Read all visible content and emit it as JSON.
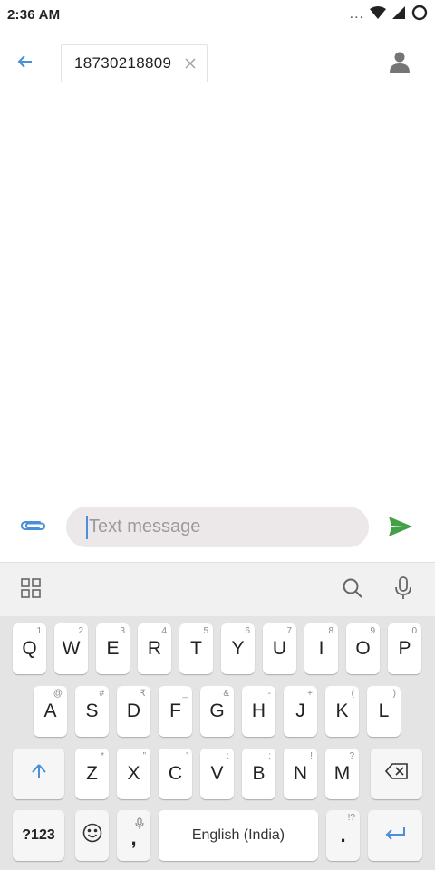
{
  "status_bar": {
    "time": "2:36 AM",
    "dots": "..."
  },
  "recipient": {
    "number": "18730218809"
  },
  "compose": {
    "placeholder": "Text message"
  },
  "keyboard": {
    "row1": [
      {
        "label": "Q",
        "hint": "1"
      },
      {
        "label": "W",
        "hint": "2"
      },
      {
        "label": "E",
        "hint": "3"
      },
      {
        "label": "R",
        "hint": "4"
      },
      {
        "label": "T",
        "hint": "5"
      },
      {
        "label": "Y",
        "hint": "6"
      },
      {
        "label": "U",
        "hint": "7"
      },
      {
        "label": "I",
        "hint": "8"
      },
      {
        "label": "O",
        "hint": "9"
      },
      {
        "label": "P",
        "hint": "0"
      }
    ],
    "row2": [
      {
        "label": "A",
        "hint": "@"
      },
      {
        "label": "S",
        "hint": "#"
      },
      {
        "label": "D",
        "hint": "₹"
      },
      {
        "label": "F",
        "hint": "_"
      },
      {
        "label": "G",
        "hint": "&"
      },
      {
        "label": "H",
        "hint": "-"
      },
      {
        "label": "J",
        "hint": "+"
      },
      {
        "label": "K",
        "hint": "("
      },
      {
        "label": "L",
        "hint": ")"
      }
    ],
    "row3": [
      {
        "label": "Z",
        "hint": "*"
      },
      {
        "label": "X",
        "hint": "\""
      },
      {
        "label": "C",
        "hint": "'"
      },
      {
        "label": "V",
        "hint": ":"
      },
      {
        "label": "B",
        "hint": ";"
      },
      {
        "label": "N",
        "hint": "!"
      },
      {
        "label": "M",
        "hint": "?"
      }
    ],
    "symbols_label": "?123",
    "comma_label": ",",
    "space_label": "English (India)",
    "period_label": ".",
    "period_hint": "!?"
  },
  "colors": {
    "accent_blue": "#4a90d9",
    "send_green": "#43a047",
    "icon_gray": "#757575"
  }
}
